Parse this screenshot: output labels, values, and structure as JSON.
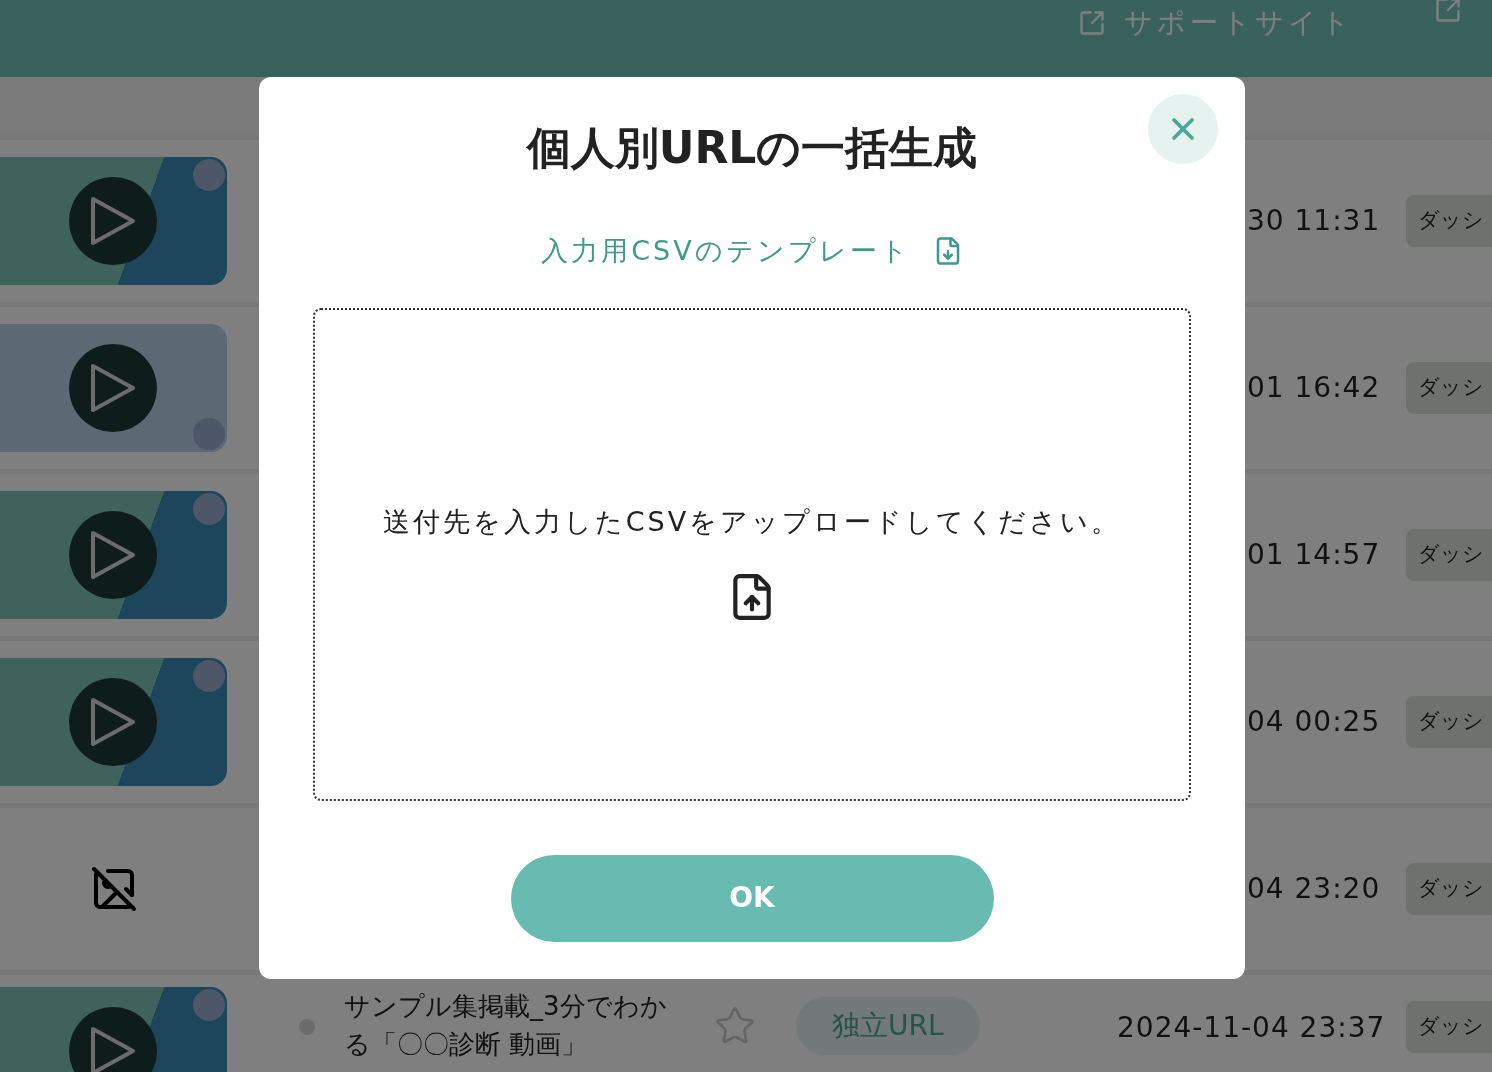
{
  "header": {
    "links": [
      {
        "label": "サポートサイト"
      }
    ]
  },
  "rows": [
    {
      "thumbnail": {
        "kind": "video"
      },
      "date": "30 11:31",
      "action": "ダッシ"
    },
    {
      "thumbnail": {
        "kind": "illustration"
      },
      "date": "01 16:42",
      "action": "ダッシ"
    },
    {
      "thumbnail": {
        "kind": "video"
      },
      "date": "01 14:57",
      "action": "ダッシ"
    },
    {
      "thumbnail": {
        "kind": "video"
      },
      "date": "04 00:25",
      "action": "ダッシ"
    },
    {
      "thumbnail": {
        "kind": "none"
      },
      "date": "04 23:20",
      "action": "ダッシ"
    },
    {
      "thumbnail": {
        "kind": "video"
      },
      "title": "サンプル集掲載_3分でわかる「〇〇診断 動画」",
      "starred": false,
      "badge": "独立URL",
      "date": "2024-11-04 23:37",
      "action": "ダッシ"
    }
  ],
  "dialog": {
    "title": "個人別URLの一括生成",
    "template_link": "入力用CSVのテンプレート",
    "dropzone_text": "送付先を入力したCSVをアップロードしてください。",
    "ok_button": "OK"
  }
}
